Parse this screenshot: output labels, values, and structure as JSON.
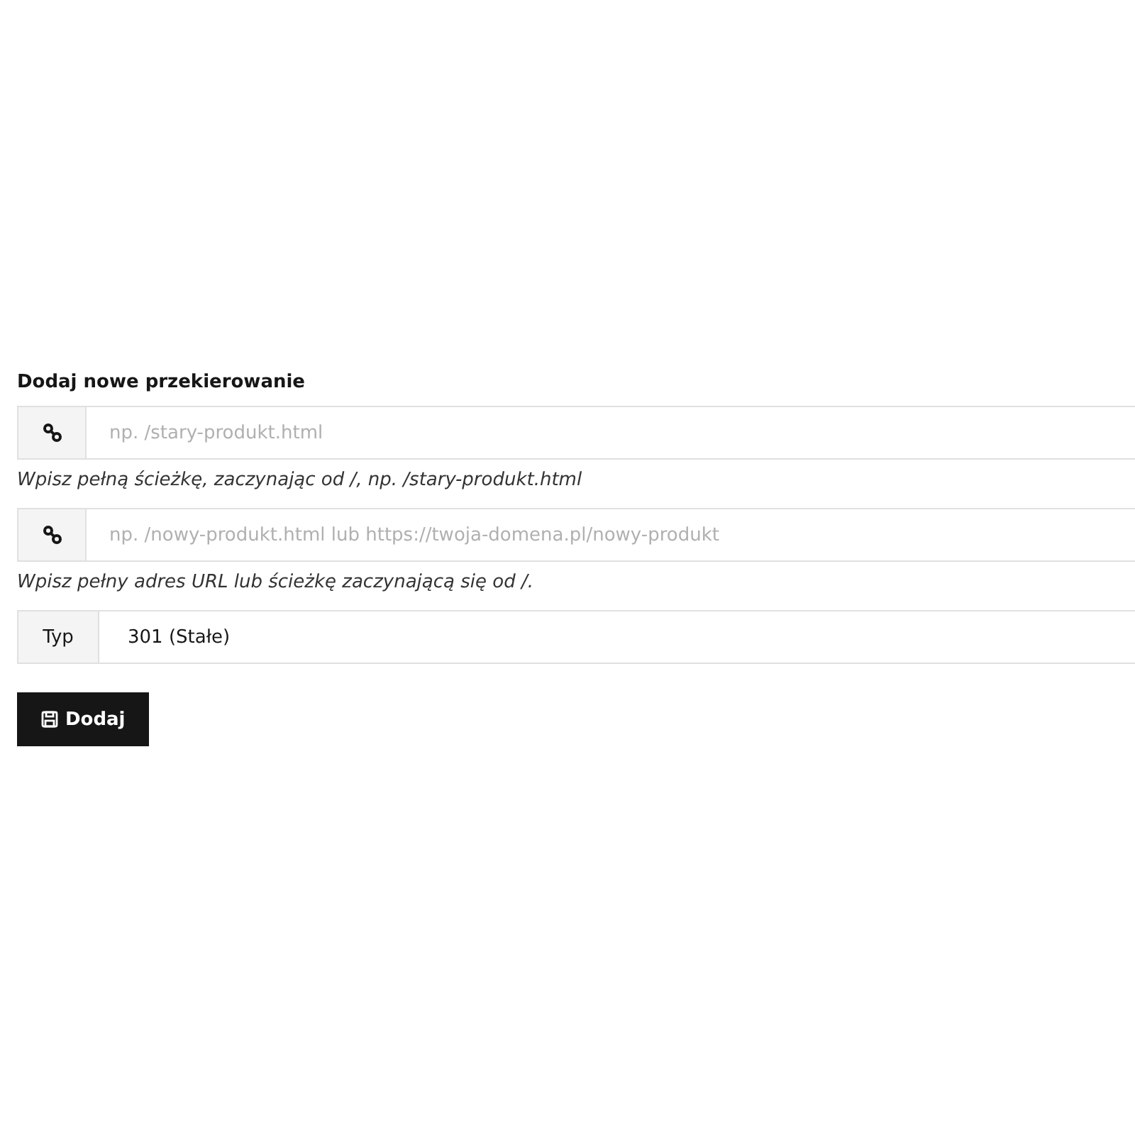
{
  "heading": "Dodaj nowe przekierowanie",
  "fields": [
    {
      "kind": "input",
      "placeholder": "np. /stary-produkt.html",
      "help": "Wpisz pełną ścieżkę, zaczynając od /, np. /stary-produkt.html"
    },
    {
      "kind": "input",
      "placeholder": "np. /nowy-produkt.html lub https://twoja-domena.pl/nowy-produkt",
      "help": "Wpisz pełny adres URL lub ścieżkę zaczynającą się od /."
    },
    {
      "kind": "select",
      "label": "Typ",
      "value": "301 (Stałe)"
    }
  ],
  "button": {
    "label": "Dodaj"
  }
}
